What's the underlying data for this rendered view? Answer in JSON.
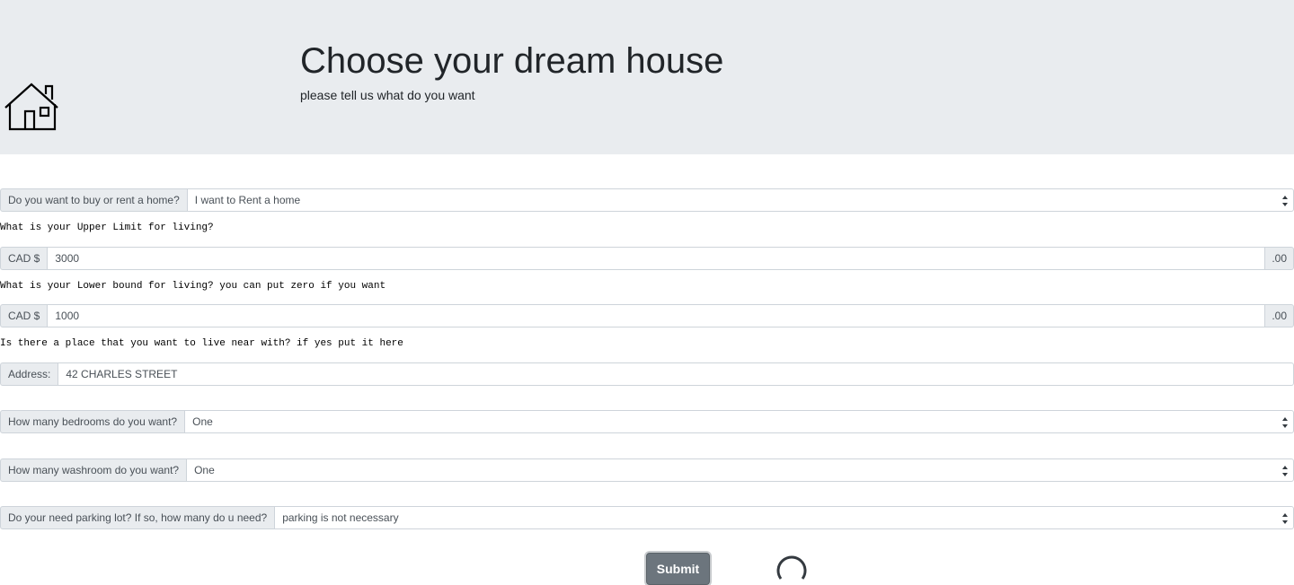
{
  "hero": {
    "title": "Choose your dream house",
    "subtitle": "please tell us what do you want",
    "icon": "house-icon"
  },
  "form": {
    "intent": {
      "label": "Do you want to buy or rent a home?",
      "selected": "I want to Rent a home"
    },
    "upper_question": "What is your Upper Limit for living?",
    "upper": {
      "prefix": "CAD $",
      "value": "3000",
      "suffix": ".00"
    },
    "lower_question": "What is your Lower bound for living? you can put zero if you want",
    "lower": {
      "prefix": "CAD $",
      "value": "1000",
      "suffix": ".00"
    },
    "address_question": "Is there a place that you want to live near with? if yes put it here",
    "address": {
      "label": "Address:",
      "value": "42 CHARLES STREET"
    },
    "bedrooms": {
      "label": "How many bedrooms do you want?",
      "selected": "One"
    },
    "washrooms": {
      "label": "How many washroom do you want?",
      "selected": "One"
    },
    "parking": {
      "label": "Do your need parking lot? If so, how many do u need?",
      "selected": "parking is not necessary"
    },
    "submit_label": "Submit"
  },
  "colors": {
    "hero_bg": "#e9ecef",
    "button_bg": "#6c757d"
  }
}
